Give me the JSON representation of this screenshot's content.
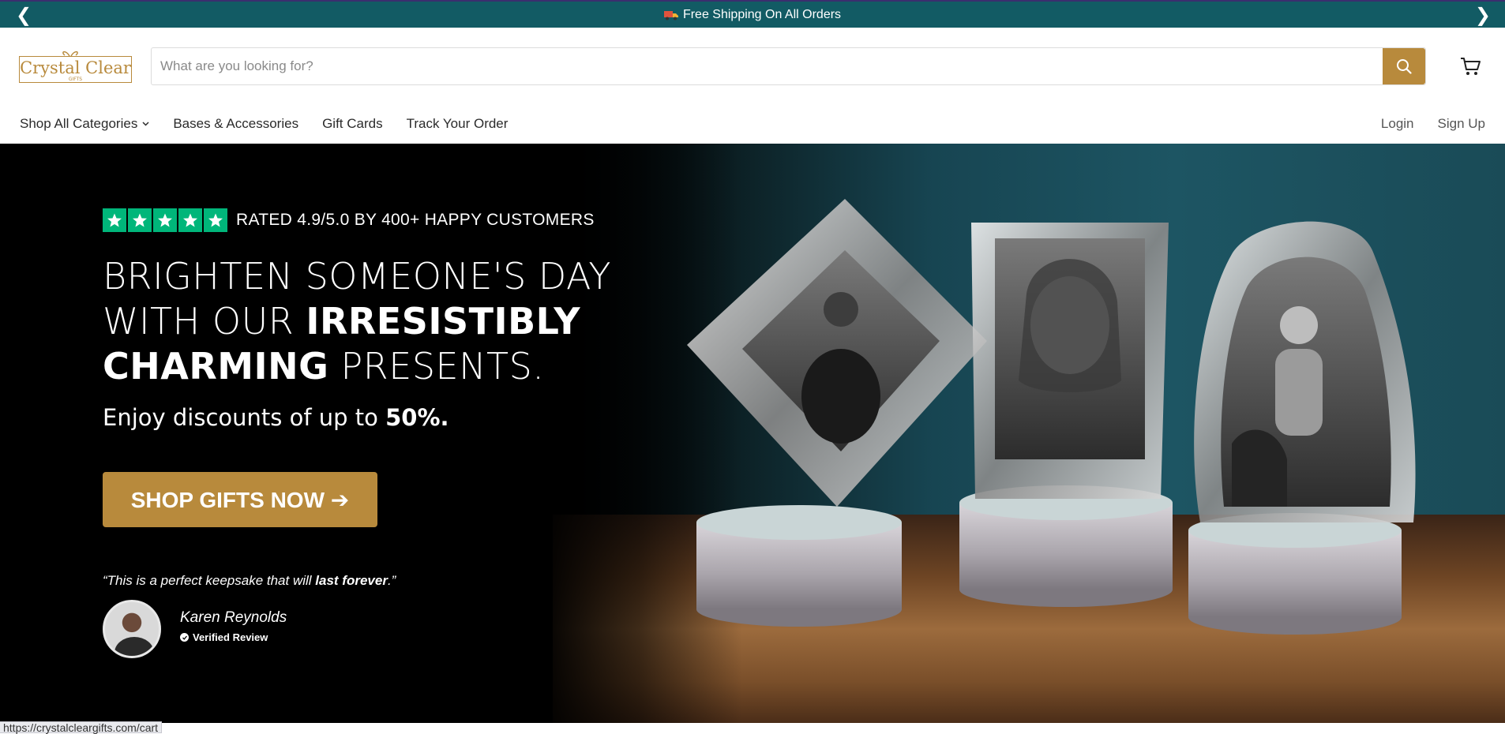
{
  "announcement": {
    "text": "Free Shipping On All Orders",
    "prev_arrow": "❮",
    "next_arrow": "❯"
  },
  "brand": {
    "logo_line1": "Crystal Clear",
    "logo_line2": "GIFTS",
    "accent_color": "#b88a3c",
    "bar_color": "#125b64"
  },
  "search": {
    "placeholder": "What are you looking for?",
    "value": ""
  },
  "nav": {
    "items": [
      {
        "label": "Shop All Categories"
      },
      {
        "label": "Bases & Accessories"
      },
      {
        "label": "Gift Cards"
      },
      {
        "label": "Track Your Order"
      }
    ],
    "login": "Login",
    "signup": "Sign Up"
  },
  "hero": {
    "rating_text": "RATED 4.9/5.0 BY 400+ HAPPY CUSTOMERS",
    "headline_1": "BRIGHTEN SOMEONE'S DAY",
    "headline_2a": "WITH OUR ",
    "headline_2b": "IRRESISTIBLY",
    "headline_3a": "CHARMING",
    "headline_3b": " PRESENTS.",
    "subline_a": "Enjoy discounts of up to ",
    "subline_b": "50%.",
    "cta_label": "SHOP GIFTS NOW ➔",
    "quote_a": "“This is a perfect keepsake that will ",
    "quote_b": "last forever",
    "quote_c": ".”",
    "reviewer_name": "Karen Reynolds",
    "verified_label": "Verified Review",
    "star_count": 5
  },
  "status_url": "https://crystalcleargifts.com/cart"
}
